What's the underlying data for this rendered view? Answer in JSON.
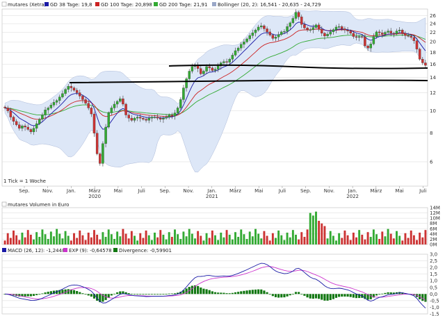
{
  "legend": {
    "items": [
      {
        "label": "mutares (Xetra)",
        "color": "#ffffff"
      },
      {
        "label": "GD 38 Tage: 19,8",
        "color": "#1a1aa6"
      },
      {
        "label": "GD 100 Tage: 20,898",
        "color": "#cc2222"
      },
      {
        "label": "GD 200 Tage: 21,91",
        "color": "#33aa33"
      },
      {
        "label": "Bollinger (20, 2): 16,541 - 20,635 - 24,729",
        "color": "#9aa7c7"
      }
    ]
  },
  "tick_note": "1 Tick = 1 Woche",
  "volume_title": "mutares Volumen in Euro",
  "macd_legend": [
    {
      "label": "MACD (26, 12): -1,2448",
      "color": "#1a1aa6"
    },
    {
      "label": "EXP (9): -0,64578",
      "color": "#cc33cc"
    },
    {
      "label": "Divergence: -0,59901",
      "color": "#117711"
    }
  ],
  "colors": {
    "up": "#33aa33",
    "down": "#cc3333",
    "band": "#dde7f7",
    "grid": "#d8d8d8"
  },
  "chart_data": [
    {
      "type": "candlestick",
      "title": "mutares (Xetra)",
      "x_ticks": [
        "Sep.",
        "Nov.",
        "Jan.",
        "März",
        "Mai",
        "Juli",
        "Sep.",
        "Nov.",
        "Jan.",
        "März",
        "Mai",
        "Juli",
        "Sep.",
        "Nov.",
        "Jan.",
        "März",
        "Mai",
        "Juli"
      ],
      "x_years": [
        "2020",
        "2021",
        "2022"
      ],
      "y_ticks": [
        6,
        8,
        10,
        12,
        14,
        16,
        18,
        20,
        22,
        24,
        26
      ],
      "ylim": [
        4.7,
        27.8
      ],
      "scale": "log",
      "close": [
        10.3,
        10.0,
        9.4,
        9.0,
        8.7,
        8.4,
        8.6,
        8.5,
        8.3,
        8.1,
        8.4,
        8.8,
        9.2,
        9.6,
        10.1,
        10.3,
        10.6,
        10.9,
        11.1,
        11.5,
        11.9,
        12.4,
        12.8,
        12.6,
        12.3,
        12.0,
        11.6,
        11.2,
        10.8,
        10.3,
        9.7,
        8.0,
        6.5,
        5.9,
        7.2,
        8.5,
        9.8,
        10.3,
        10.7,
        11.0,
        11.3,
        10.7,
        9.6,
        9.3,
        9.1,
        9.3,
        9.4,
        9.3,
        9.2,
        9.1,
        9.3,
        9.4,
        9.4,
        9.3,
        9.2,
        9.3,
        9.4,
        9.6,
        9.5,
        9.8,
        10.3,
        11.2,
        12.6,
        13.8,
        14.9,
        15.6,
        15.9,
        15.3,
        14.5,
        14.9,
        15.6,
        15.4,
        15.0,
        15.2,
        15.7,
        16.2,
        16.4,
        16.3,
        16.8,
        17.5,
        18.3,
        18.8,
        19.5,
        20.0,
        20.6,
        21.3,
        21.9,
        22.5,
        23.2,
        23.5,
        22.8,
        22.1,
        21.4,
        20.7,
        21.0,
        21.5,
        22.1,
        22.2,
        23.3,
        24.2,
        25.3,
        26.9,
        25.7,
        23.8,
        23.0,
        22.6,
        22.6,
        23.1,
        23.7,
        22.7,
        21.8,
        21.2,
        21.6,
        22.1,
        22.6,
        23.2,
        23.3,
        22.8,
        22.5,
        22.3,
        21.8,
        21.1,
        20.9,
        21.1,
        21.0,
        19.2,
        18.8,
        19.6,
        21.1,
        22.1,
        21.9,
        21.6,
        22.0,
        22.3,
        21.8,
        21.7,
        22.3,
        22.5,
        21.8,
        21.3,
        21.2,
        20.9,
        20.2,
        18.6,
        16.8,
        16.2,
        15.8
      ],
      "series": [
        {
          "name": "GD 38 Tage",
          "value": 19.8
        },
        {
          "name": "GD 100 Tage",
          "value": 20.898
        },
        {
          "name": "GD 200 Tage",
          "value": 21.91
        },
        {
          "name": "Bollinger (20, 2)",
          "values": [
            16.541,
            20.635,
            24.729
          ]
        }
      ],
      "annotations": [
        "trendline near 16",
        "trendline near 14"
      ]
    },
    {
      "type": "bar",
      "title": "mutares Volumen in Euro",
      "y_ticks": [
        "0M",
        "2M",
        "4M",
        "6M",
        "8M",
        "10M",
        "12M",
        "14M"
      ],
      "ylim": [
        0,
        14
      ],
      "note": "weekly volume bars, green = up week, red = down week",
      "peak_millions": 12.5
    },
    {
      "type": "bar",
      "title": "MACD (26, 12)",
      "y_ticks": [
        "-1,5",
        "-1,0",
        "-0,5",
        "0,0",
        "0,5",
        "1,0",
        "1,5",
        "2,0",
        "2,5",
        "3,0"
      ],
      "ylim": [
        -1.5,
        3.0
      ],
      "series": [
        {
          "name": "MACD (26, 12)",
          "last": -1.2448
        },
        {
          "name": "EXP (9)",
          "last": -0.64578
        },
        {
          "name": "Divergence",
          "last": -0.59901
        }
      ]
    }
  ]
}
